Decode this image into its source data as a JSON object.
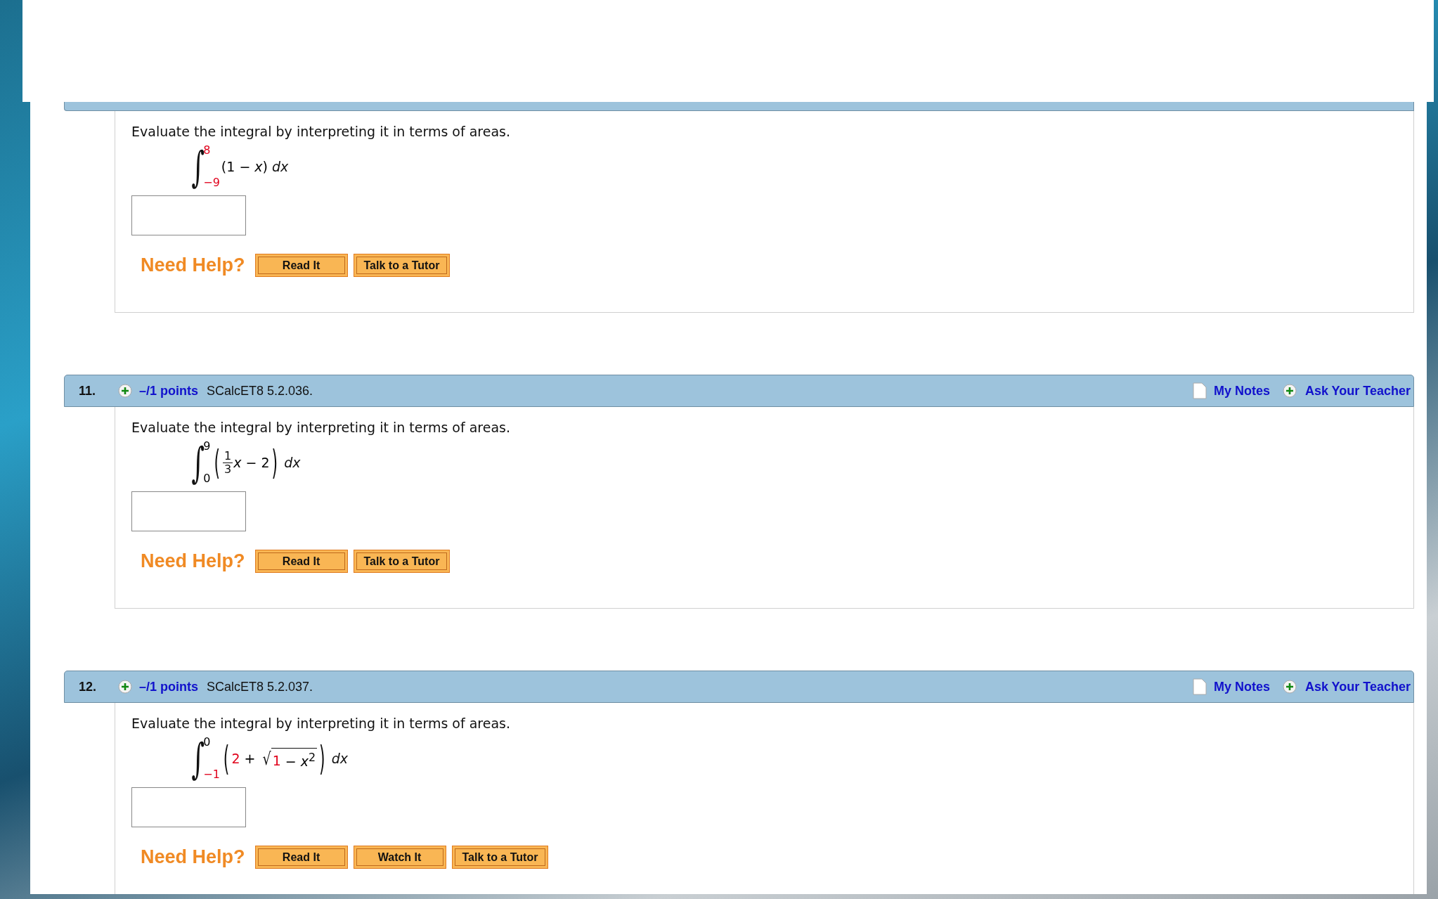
{
  "questions": [
    {
      "kind": "partial",
      "prompt": "Evaluate the integral by interpreting it in terms of areas.",
      "integral": {
        "symbol": "∫",
        "upper": {
          "text": "8",
          "color": "#e0001b"
        },
        "lower": {
          "text": "−9",
          "color": "#e0001b"
        },
        "body": [
          {
            "kind": "text",
            "text": "(1 − *x*)",
            "color": "#000000"
          }
        ],
        "differential": "dx"
      },
      "help_label": "Need Help?",
      "help_buttons": [
        "Read It",
        "Talk to a Tutor"
      ]
    },
    {
      "kind": "full",
      "number": "11.",
      "points": "–/1 points",
      "code": "SCalcET8 5.2.036.",
      "notes": "My Notes",
      "ask": "Ask Your Teacher",
      "prompt": "Evaluate the integral by interpreting it in terms of areas.",
      "integral": {
        "symbol": "∫",
        "upper": {
          "text": "9",
          "color": "#000000"
        },
        "lower": {
          "text": "0",
          "color": "#000000"
        },
        "body": [
          {
            "kind": "paren",
            "open": "(",
            "close": ")",
            "children": [
              {
                "kind": "frac",
                "num": "1",
                "den": "3"
              },
              {
                "kind": "text",
                "text": "*x* − 2",
                "color": "#000000"
              }
            ]
          }
        ],
        "differential": "dx"
      },
      "help_label": "Need Help?",
      "help_buttons": [
        "Read It",
        "Talk to a Tutor"
      ]
    },
    {
      "kind": "full",
      "number": "12.",
      "points": "–/1 points",
      "code": "SCalcET8 5.2.037.",
      "notes": "My Notes",
      "ask": "Ask Your Teacher",
      "prompt": "Evaluate the integral by interpreting it in terms of areas.",
      "integral": {
        "symbol": "∫",
        "upper": {
          "text": "0",
          "color": "#000000"
        },
        "lower": {
          "text": "−1",
          "color": "#e0001b"
        },
        "body": [
          {
            "kind": "paren",
            "open": "(",
            "close": ")",
            "children": [
              {
                "kind": "text",
                "text": "2",
                "color": "#e0001b"
              },
              {
                "kind": "text",
                "text": " + ",
                "color": "#000000"
              },
              {
                "kind": "sqrt",
                "radical": "√",
                "children": [
                  {
                    "kind": "text",
                    "text": "1",
                    "color": "#e0001b"
                  },
                  {
                    "kind": "text",
                    "text": " − *x*$^{2}$",
                    "color": "#000000"
                  }
                ]
              }
            ]
          }
        ],
        "differential": "dx"
      },
      "help_label": "Need Help?",
      "help_buttons": [
        "Read It",
        "Watch It",
        "Talk to a Tutor"
      ]
    }
  ]
}
